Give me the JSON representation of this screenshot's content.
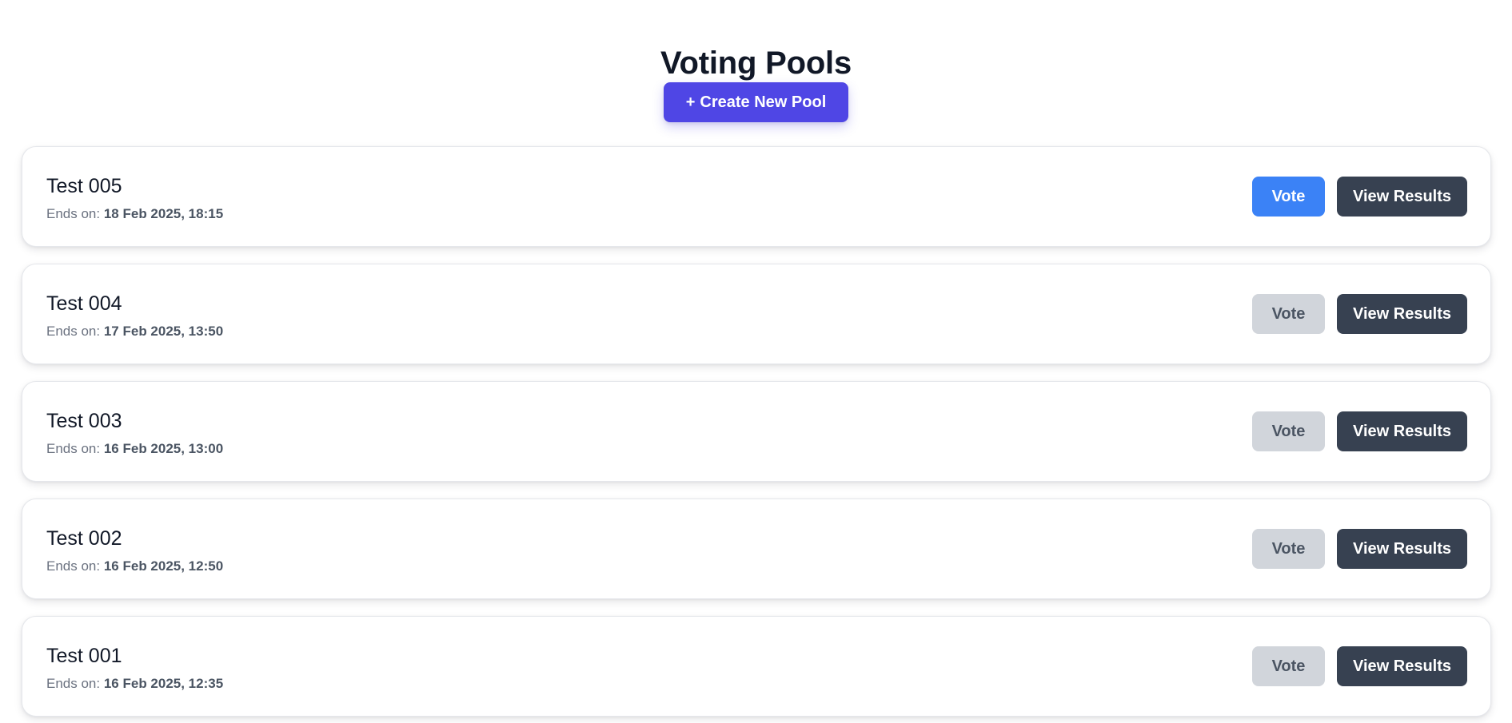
{
  "page": {
    "title": "Voting Pools",
    "create_button": {
      "icon": "+",
      "label": "Create New Pool"
    }
  },
  "pools": [
    {
      "name": "Test 005",
      "ends_label": "Ends on:",
      "ends_date": "18 Feb 2025, 18:15",
      "vote_label": "Vote",
      "vote_enabled": true,
      "results_label": "View Results"
    },
    {
      "name": "Test 004",
      "ends_label": "Ends on:",
      "ends_date": "17 Feb 2025, 13:50",
      "vote_label": "Vote",
      "vote_enabled": false,
      "results_label": "View Results"
    },
    {
      "name": "Test 003",
      "ends_label": "Ends on:",
      "ends_date": "16 Feb 2025, 13:00",
      "vote_label": "Vote",
      "vote_enabled": false,
      "results_label": "View Results"
    },
    {
      "name": "Test 002",
      "ends_label": "Ends on:",
      "ends_date": "16 Feb 2025, 12:50",
      "vote_label": "Vote",
      "vote_enabled": false,
      "results_label": "View Results"
    },
    {
      "name": "Test 001",
      "ends_label": "Ends on:",
      "ends_date": "16 Feb 2025, 12:35",
      "vote_label": "Vote",
      "vote_enabled": false,
      "results_label": "View Results"
    }
  ],
  "colors": {
    "primary": "#4f46e5",
    "vote_active": "#3b82f6",
    "vote_disabled": "#d1d5db",
    "results": "#374151",
    "text": "#111827",
    "muted": "#6b7280"
  }
}
